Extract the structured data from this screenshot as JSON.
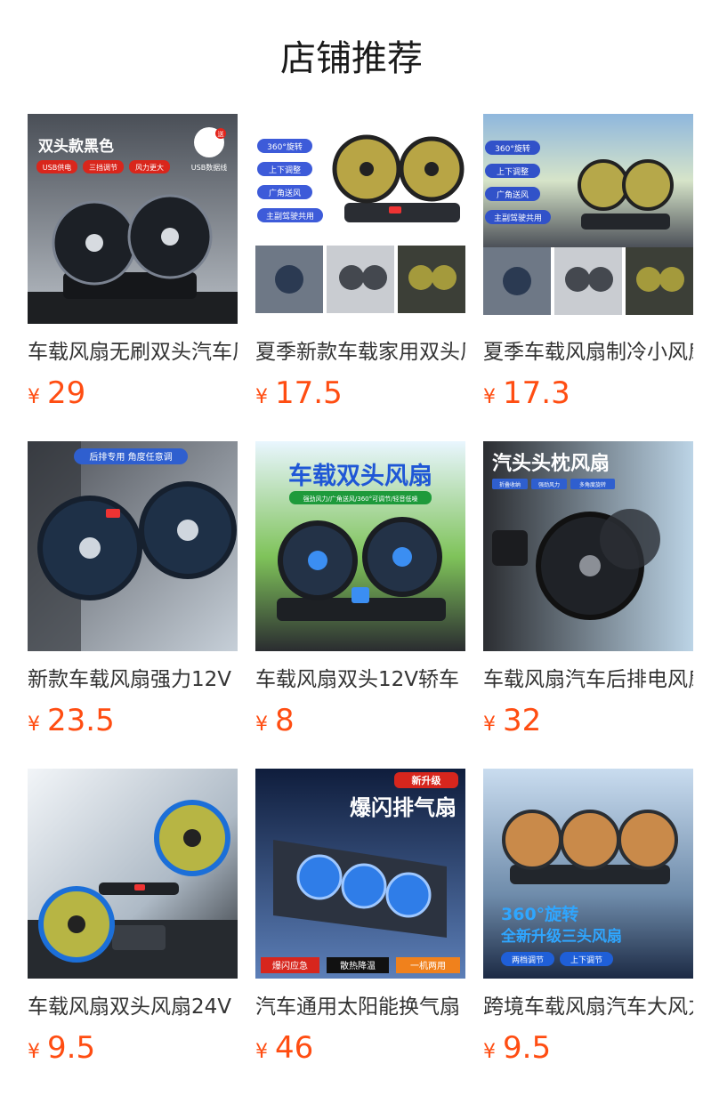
{
  "header": {
    "title": "店铺推荐"
  },
  "products": [
    {
      "name": "车载风扇无刷双头汽车风扇",
      "currency": "¥",
      "price": "29",
      "image_text": {
        "headline": "双头款黑色",
        "tags": [
          "USB供电",
          "三挡调节",
          "风力更大"
        ],
        "badge": "送",
        "cable_label": "USB数据线"
      }
    },
    {
      "name": "夏季新款车载家用双头风扇",
      "currency": "¥",
      "price": "17.5",
      "image_text": {
        "tags": [
          "360°旋转",
          "上下调整",
          "广角送风",
          "主副驾驶共用"
        ]
      }
    },
    {
      "name": "夏季车载风扇制冷小风扇",
      "currency": "¥",
      "price": "17.3",
      "image_text": {
        "tags": [
          "360°旋转",
          "上下调整",
          "广角送风",
          "主副驾驶共用"
        ]
      }
    },
    {
      "name": "新款车载风扇强力12V",
      "currency": "¥",
      "price": "23.5",
      "image_text": {
        "banner": "后排专用 角度任意调"
      }
    },
    {
      "name": "车载风扇双头12V轿车",
      "currency": "¥",
      "price": "8",
      "image_text": {
        "headline": "车载双头风扇",
        "subline": "强劲风力/广角送风/360°可调节/轻音低噪"
      }
    },
    {
      "name": "车载风扇汽车后排电风扇",
      "currency": "¥",
      "price": "32",
      "image_text": {
        "headline": "汽头头枕风扇",
        "tags": [
          "折叠收纳",
          "强劲风力",
          "多角度旋转"
        ]
      }
    },
    {
      "name": "车载风扇双头风扇24V",
      "currency": "¥",
      "price": "9.5",
      "image_text": {}
    },
    {
      "name": "汽车通用太阳能换气扇",
      "currency": "¥",
      "price": "46",
      "image_text": {
        "badge": "新升级",
        "headline": "爆闪排气扇",
        "tags": [
          "爆闪应急",
          "散热降温",
          "一机两用"
        ]
      }
    },
    {
      "name": "跨境车载风扇汽车大风力",
      "currency": "¥",
      "price": "9.5",
      "image_text": {
        "headline1": "360°旋转",
        "headline2": "全新升级三头风扇",
        "tags": [
          "两档调节",
          "上下调节"
        ]
      }
    }
  ]
}
